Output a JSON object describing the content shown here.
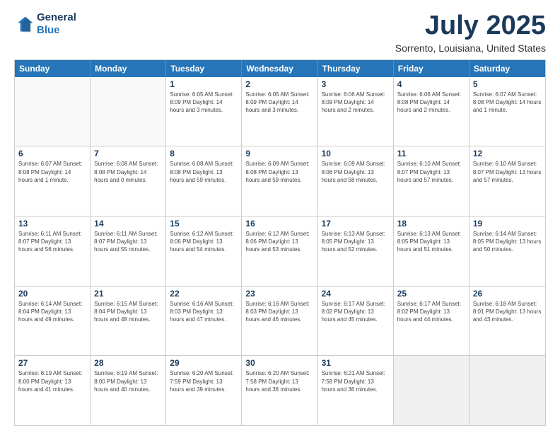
{
  "header": {
    "logo": {
      "line1": "General",
      "line2": "Blue"
    },
    "title": "July 2025",
    "location": "Sorrento, Louisiana, United States"
  },
  "dayHeaders": [
    "Sunday",
    "Monday",
    "Tuesday",
    "Wednesday",
    "Thursday",
    "Friday",
    "Saturday"
  ],
  "weeks": [
    [
      {
        "day": "",
        "empty": true
      },
      {
        "day": "",
        "empty": true
      },
      {
        "day": "1",
        "info": "Sunrise: 6:05 AM\nSunset: 8:09 PM\nDaylight: 14 hours\nand 3 minutes."
      },
      {
        "day": "2",
        "info": "Sunrise: 6:05 AM\nSunset: 8:09 PM\nDaylight: 14 hours\nand 3 minutes."
      },
      {
        "day": "3",
        "info": "Sunrise: 6:06 AM\nSunset: 8:09 PM\nDaylight: 14 hours\nand 2 minutes."
      },
      {
        "day": "4",
        "info": "Sunrise: 6:06 AM\nSunset: 8:08 PM\nDaylight: 14 hours\nand 2 minutes."
      },
      {
        "day": "5",
        "info": "Sunrise: 6:07 AM\nSunset: 8:08 PM\nDaylight: 14 hours\nand 1 minute."
      }
    ],
    [
      {
        "day": "6",
        "info": "Sunrise: 6:07 AM\nSunset: 8:08 PM\nDaylight: 14 hours\nand 1 minute."
      },
      {
        "day": "7",
        "info": "Sunrise: 6:08 AM\nSunset: 8:08 PM\nDaylight: 14 hours\nand 0 minutes."
      },
      {
        "day": "8",
        "info": "Sunrise: 6:08 AM\nSunset: 8:08 PM\nDaylight: 13 hours\nand 59 minutes."
      },
      {
        "day": "9",
        "info": "Sunrise: 6:09 AM\nSunset: 8:08 PM\nDaylight: 13 hours\nand 59 minutes."
      },
      {
        "day": "10",
        "info": "Sunrise: 6:09 AM\nSunset: 8:08 PM\nDaylight: 13 hours\nand 58 minutes."
      },
      {
        "day": "11",
        "info": "Sunrise: 6:10 AM\nSunset: 8:07 PM\nDaylight: 13 hours\nand 57 minutes."
      },
      {
        "day": "12",
        "info": "Sunrise: 6:10 AM\nSunset: 8:07 PM\nDaylight: 13 hours\nand 57 minutes."
      }
    ],
    [
      {
        "day": "13",
        "info": "Sunrise: 6:11 AM\nSunset: 8:07 PM\nDaylight: 13 hours\nand 56 minutes."
      },
      {
        "day": "14",
        "info": "Sunrise: 6:11 AM\nSunset: 8:07 PM\nDaylight: 13 hours\nand 55 minutes."
      },
      {
        "day": "15",
        "info": "Sunrise: 6:12 AM\nSunset: 8:06 PM\nDaylight: 13 hours\nand 54 minutes."
      },
      {
        "day": "16",
        "info": "Sunrise: 6:12 AM\nSunset: 8:06 PM\nDaylight: 13 hours\nand 53 minutes."
      },
      {
        "day": "17",
        "info": "Sunrise: 6:13 AM\nSunset: 8:05 PM\nDaylight: 13 hours\nand 52 minutes."
      },
      {
        "day": "18",
        "info": "Sunrise: 6:13 AM\nSunset: 8:05 PM\nDaylight: 13 hours\nand 51 minutes."
      },
      {
        "day": "19",
        "info": "Sunrise: 6:14 AM\nSunset: 8:05 PM\nDaylight: 13 hours\nand 50 minutes."
      }
    ],
    [
      {
        "day": "20",
        "info": "Sunrise: 6:14 AM\nSunset: 8:04 PM\nDaylight: 13 hours\nand 49 minutes."
      },
      {
        "day": "21",
        "info": "Sunrise: 6:15 AM\nSunset: 8:04 PM\nDaylight: 13 hours\nand 48 minutes."
      },
      {
        "day": "22",
        "info": "Sunrise: 6:16 AM\nSunset: 8:03 PM\nDaylight: 13 hours\nand 47 minutes."
      },
      {
        "day": "23",
        "info": "Sunrise: 6:16 AM\nSunset: 8:03 PM\nDaylight: 13 hours\nand 46 minutes."
      },
      {
        "day": "24",
        "info": "Sunrise: 6:17 AM\nSunset: 8:02 PM\nDaylight: 13 hours\nand 45 minutes."
      },
      {
        "day": "25",
        "info": "Sunrise: 6:17 AM\nSunset: 8:02 PM\nDaylight: 13 hours\nand 44 minutes."
      },
      {
        "day": "26",
        "info": "Sunrise: 6:18 AM\nSunset: 8:01 PM\nDaylight: 13 hours\nand 43 minutes."
      }
    ],
    [
      {
        "day": "27",
        "info": "Sunrise: 6:19 AM\nSunset: 8:00 PM\nDaylight: 13 hours\nand 41 minutes."
      },
      {
        "day": "28",
        "info": "Sunrise: 6:19 AM\nSunset: 8:00 PM\nDaylight: 13 hours\nand 40 minutes."
      },
      {
        "day": "29",
        "info": "Sunrise: 6:20 AM\nSunset: 7:59 PM\nDaylight: 13 hours\nand 39 minutes."
      },
      {
        "day": "30",
        "info": "Sunrise: 6:20 AM\nSunset: 7:58 PM\nDaylight: 13 hours\nand 38 minutes."
      },
      {
        "day": "31",
        "info": "Sunrise: 6:21 AM\nSunset: 7:58 PM\nDaylight: 13 hours\nand 36 minutes."
      },
      {
        "day": "",
        "empty": true,
        "shaded": true
      },
      {
        "day": "",
        "empty": true,
        "shaded": true
      }
    ]
  ]
}
